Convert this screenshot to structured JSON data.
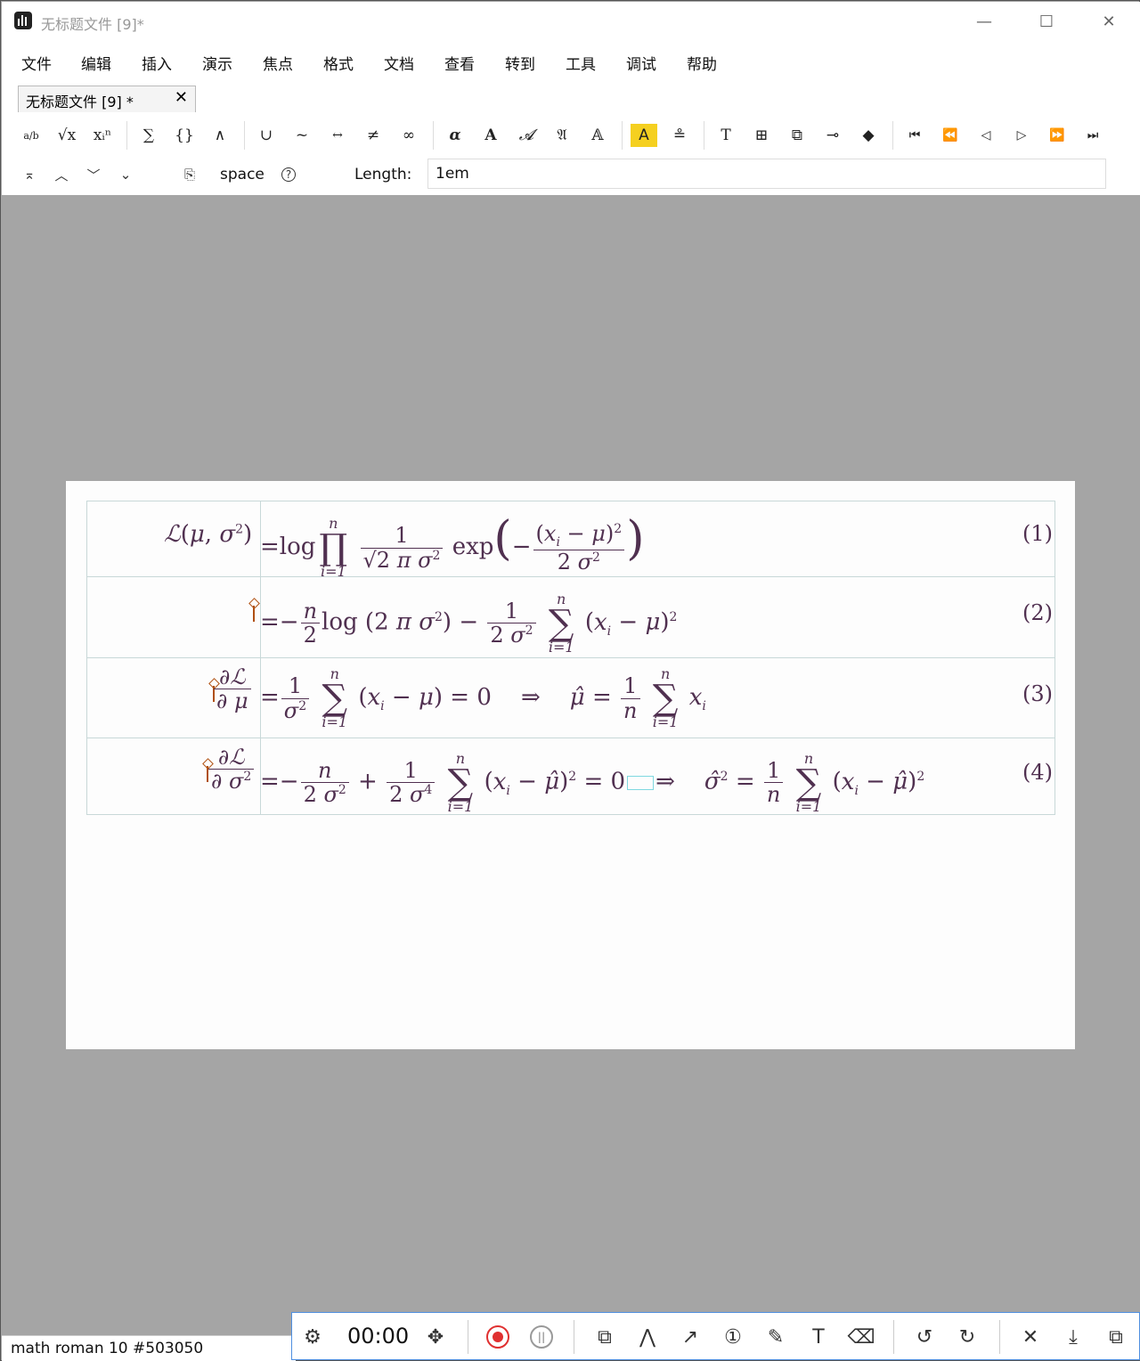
{
  "window": {
    "title": "无标题文件 [9]*",
    "controls": {
      "minimize": "—",
      "maximize": "☐",
      "close": "✕"
    }
  },
  "menu": [
    "文件",
    "编辑",
    "插入",
    "演示",
    "焦点",
    "格式",
    "文档",
    "查看",
    "转到",
    "工具",
    "调试",
    "帮助"
  ],
  "tab": {
    "label": "无标题文件 [9] *",
    "close": "✕"
  },
  "toolbar": {
    "fraction": "a/b",
    "sqrt": "√x",
    "subsup": "xᵢⁿ",
    "big_op": "∑",
    "brackets": "{}",
    "wedge": "∧",
    "union": "∪",
    "tilde": "~",
    "arrow": "↔",
    "neq": "≠",
    "infinity": "∞",
    "greek": "α",
    "bold": "A",
    "calligraphic": "𝓐",
    "fraktur": "𝔄",
    "outline": "𝔸",
    "highlight": "A",
    "stamp": "≗",
    "text": "T",
    "table": "⊞",
    "image": "⧉",
    "link": "⊸",
    "eraser": "◆",
    "first": "⏮",
    "prev_fast": "⏪",
    "prev": "◁",
    "next": "▷",
    "next_fast": "⏩",
    "last": "⏭",
    "highlight_color": "#f5d020"
  },
  "focusbar": {
    "top": "⌅",
    "up": "︿",
    "down": "﹀",
    "bottom": "⌄",
    "settings": "⎘",
    "mode_label": "space",
    "help": "?",
    "length_label": "Length:",
    "length_value": "1em"
  },
  "equations": {
    "color": "#503050",
    "labels": [
      "(1)",
      "(2)",
      "(3)",
      "(4)"
    ]
  },
  "status": {
    "text": "math roman 10 #503050"
  },
  "recorder": {
    "time": "00:00",
    "settings": "⚙",
    "move": "✥",
    "shapes": "⧉",
    "path": "⋀",
    "arrow": "↗",
    "number": "①",
    "pen": "✎",
    "text": "T",
    "eraser": "⌫",
    "undo": "↺",
    "redo": "↻",
    "close": "✕",
    "download": "⤓",
    "copy": "⧉",
    "record_color": "#e03030"
  }
}
